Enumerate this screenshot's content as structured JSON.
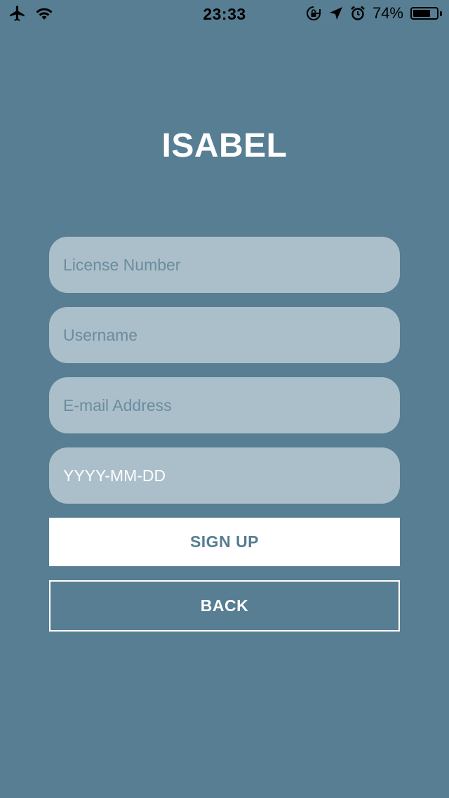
{
  "status_bar": {
    "time": "23:33",
    "battery_percent_label": "74%",
    "battery_level": 0.74,
    "icons": [
      "airplane-icon",
      "wifi-icon",
      "rotation-lock-icon",
      "location-arrow-icon",
      "alarm-icon",
      "battery-icon"
    ]
  },
  "app": {
    "title": "ISABEL"
  },
  "form": {
    "license_placeholder": "License Number",
    "username_placeholder": "Username",
    "email_placeholder": "E-mail Address",
    "date_placeholder": "YYYY-MM-DD",
    "signup_label": "SIGN UP",
    "back_label": "BACK"
  },
  "colors": {
    "background": "#577e92",
    "field_background": "#abbfca",
    "placeholder": "#6b8c9e",
    "button_primary_bg": "#ffffff",
    "button_primary_text": "#577e92"
  }
}
